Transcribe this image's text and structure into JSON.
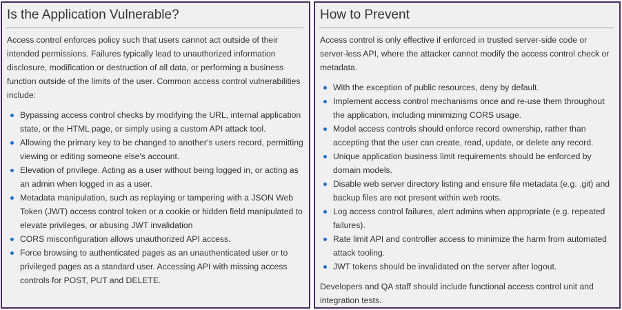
{
  "left": {
    "title": "Is the Application Vulnerable?",
    "intro": "Access control enforces policy such that users cannot act outside of their intended permissions. Failures typically lead to unauthorized information disclosure, modification or destruction of all data, or performing a business function outside of the limits of the user. Common access control vulnerabilities include:",
    "items": [
      "Bypassing access control checks by modifying the URL, internal application state, or the HTML page, or simply using a custom API attack tool.",
      "Allowing the primary key to be changed to another's users record, permitting viewing or editing someone else's account.",
      "Elevation of privilege. Acting as a user without being logged in, or acting as an admin when logged in as a user.",
      "Metadata manipulation, such as replaying or tampering with a JSON Web Token (JWT) access control token or a cookie or hidden field manipulated to elevate privileges, or abusing JWT invalidation",
      "CORS misconfiguration allows unauthorized API access.",
      "Force browsing to authenticated pages as an unauthenticated user or to privileged pages as a standard user. Accessing API with missing access controls for POST, PUT and DELETE."
    ]
  },
  "right": {
    "title": "How to Prevent",
    "intro": "Access control is only effective if enforced in trusted server-side code or server-less API, where the attacker cannot modify the access control check or metadata.",
    "items": [
      "With the exception of public resources, deny by default.",
      "Implement access control mechanisms once and re-use them throughout the application, including minimizing CORS usage.",
      "Model access controls should enforce record ownership, rather than accepting that the user can create, read, update, or delete any record.",
      "Unique application business limit requirements should be enforced by domain models.",
      "Disable web server directory listing and ensure file metadata (e.g. .git) and backup files are not present within web roots.",
      "Log access control failures, alert admins when appropriate (e.g. repeated failures).",
      "Rate limit API and controller access to minimize the harm from automated attack tooling.",
      "JWT tokens should be invalidated on the server after logout."
    ],
    "outro": "Developers and QA staff should include functional access control unit and integration tests."
  },
  "colors": {
    "border": "#4a2a5e",
    "panel_bg": "#f0f0f2",
    "bullet": "#1f6fc5",
    "text": "#333333"
  }
}
